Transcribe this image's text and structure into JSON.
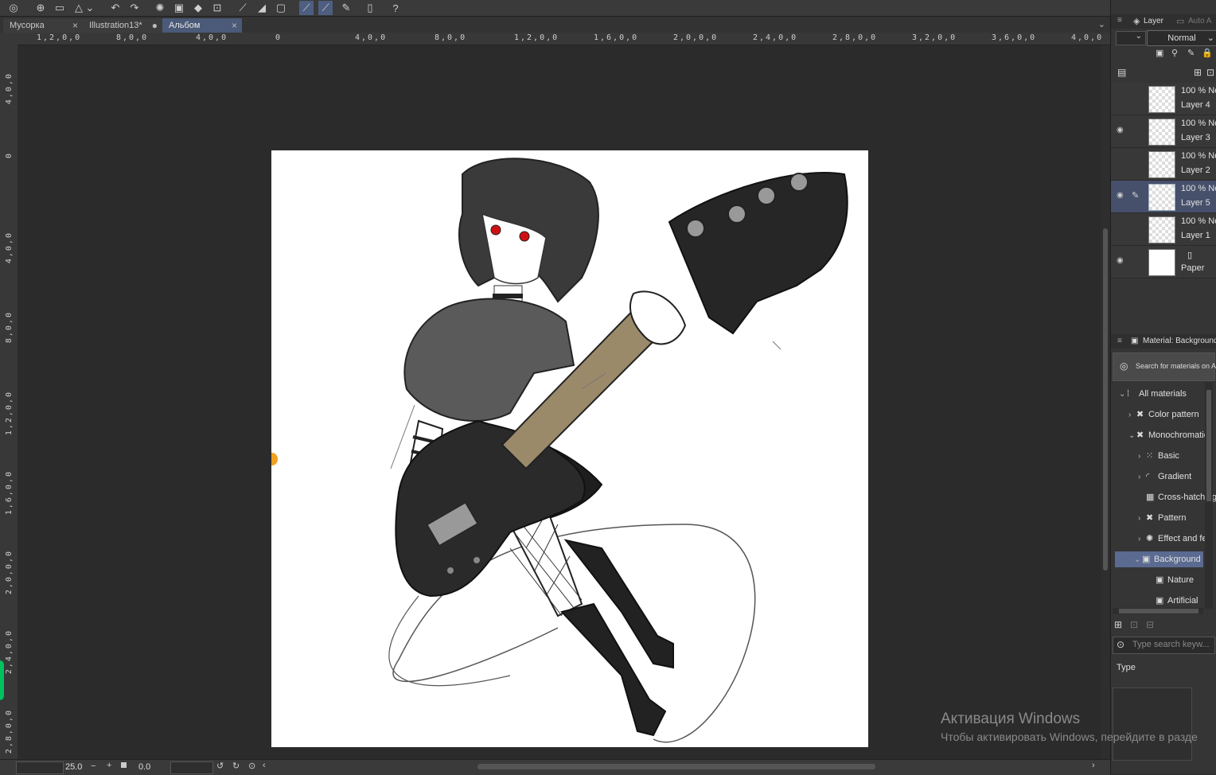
{
  "tabs": [
    {
      "label": "Мусорка",
      "close": "×"
    },
    {
      "label": "Illustration13*",
      "close": "●"
    },
    {
      "label": "Альбом",
      "close": "×"
    }
  ],
  "rulers": {
    "horizontal": [
      "1,2,0,0",
      "8,0,0",
      "4,0,0",
      "0",
      "4,0,0",
      "8,0,0",
      "1,2,0,0",
      "1,6,0,0",
      "2,0,0,0",
      "2,4,0,0",
      "2,8,0,0",
      "3,2,0,0",
      "3,6,0,0",
      "4,0,0"
    ],
    "vertical": [
      "4,0,0",
      "0",
      "4,0,0",
      "8,0,0",
      "1,2,0,0",
      "1,6,0,0",
      "2,0,0,0",
      "2,4,0,0",
      "2,8,0,0"
    ]
  },
  "status": {
    "zoom": "25.0",
    "angle": "0.0",
    "minus": "−",
    "plus": "+"
  },
  "layer_panel": {
    "tab_label": "Layer",
    "tab2_label": "Auto A",
    "blend_mode": "Normal",
    "layers": [
      {
        "opacity": "100 % No",
        "name": "Layer 4",
        "visible": false,
        "selected": false
      },
      {
        "opacity": "100 % No",
        "name": "Layer 3",
        "visible": true,
        "selected": false
      },
      {
        "opacity": "100 % No",
        "name": "Layer 2",
        "visible": false,
        "selected": false
      },
      {
        "opacity": "100 % No",
        "name": "Layer 5",
        "visible": true,
        "selected": true
      },
      {
        "opacity": "100 % No",
        "name": "Layer 1",
        "visible": false,
        "selected": false
      },
      {
        "opacity": "",
        "name": "Paper",
        "visible": true,
        "selected": false
      }
    ]
  },
  "material_panel": {
    "title": "Material: Background",
    "search_assets": "Search for materials on AS",
    "tree": [
      {
        "label": "All materials",
        "indent": 0,
        "chevron": "⌄"
      },
      {
        "label": "Color pattern",
        "indent": 1,
        "chevron": "›"
      },
      {
        "label": "Monochromatic",
        "indent": 1,
        "chevron": "⌄"
      },
      {
        "label": "Basic",
        "indent": 2,
        "chevron": "›"
      },
      {
        "label": "Gradient",
        "indent": 2,
        "chevron": "›"
      },
      {
        "label": "Cross-hatching",
        "indent": 2,
        "chevron": ""
      },
      {
        "label": "Pattern",
        "indent": 2,
        "chevron": "›"
      },
      {
        "label": "Effect and fe",
        "indent": 2,
        "chevron": "›"
      },
      {
        "label": "Background",
        "indent": 2,
        "chevron": "⌄",
        "selected": true
      },
      {
        "label": "Nature",
        "indent": 3,
        "chevron": ""
      },
      {
        "label": "Artificial",
        "indent": 3,
        "chevron": ""
      }
    ],
    "search_placeholder": "Type search keyw...",
    "type_label": "Type"
  },
  "watermark": {
    "line1": "Активация Windows",
    "line2": "Чтобы активировать Windows, перейдите в разде"
  }
}
